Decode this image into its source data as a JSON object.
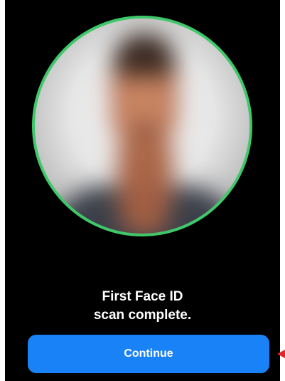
{
  "face_scan": {
    "ring_color": "#3fc86a",
    "image_description": "blurred-face-photo"
  },
  "title": {
    "line1": "First Face ID",
    "line2": "scan complete."
  },
  "continue_button": {
    "label": "Continue",
    "color": "#1a82f7"
  },
  "annotation": {
    "pointer_color": "#e3262b",
    "icon": "left-arrow-pointer-icon"
  }
}
